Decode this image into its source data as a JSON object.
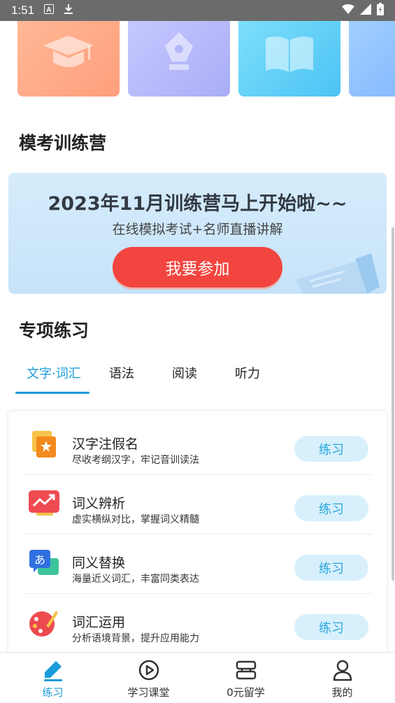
{
  "status_bar": {
    "time": "1:51",
    "icons": [
      "a-icon",
      "download-icon",
      "wifi-icon",
      "signal-icon",
      "battery-icon"
    ]
  },
  "top_cards": [
    {
      "name": "graduation-cap-icon",
      "color": "#ffa685"
    },
    {
      "name": "pen-nib-icon",
      "color": "#b4b7f9"
    },
    {
      "name": "open-book-icon",
      "color": "#5ecbf6"
    },
    {
      "name": "card-icon",
      "color": "#8dbcff"
    }
  ],
  "mock_exam": {
    "section_title": "模考训练营",
    "banner_title": "2023年11月训练营马上开始啦~~",
    "banner_subtitle": "在线模拟考试+名师直播讲解",
    "join_button": "我要参加"
  },
  "practice": {
    "section_title": "专项练习",
    "tabs": [
      "文字·词汇",
      "语法",
      "阅读",
      "听力"
    ],
    "active_tab": 0,
    "items": [
      {
        "title": "汉字注假名",
        "desc": "尽收考纲汉字，牢记音训读法",
        "button": "练习",
        "icon": "kanji-star-icon"
      },
      {
        "title": "词义辨析",
        "desc": "虚实横纵对比，掌握词义精髓",
        "button": "练习",
        "icon": "trend-chart-icon"
      },
      {
        "title": "同义替换",
        "desc": "海量近义词汇，丰富同类表达",
        "button": "练习",
        "icon": "translate-chat-icon"
      },
      {
        "title": "词汇运用",
        "desc": "分析语境背景，提升应用能力",
        "button": "练习",
        "icon": "palette-icon"
      }
    ]
  },
  "bottom_nav": [
    {
      "label": "练习",
      "icon": "pencil-icon",
      "active": true
    },
    {
      "label": "学习课堂",
      "icon": "play-circle-icon",
      "active": false
    },
    {
      "label": "0元留学",
      "icon": "layers-icon",
      "active": false
    },
    {
      "label": "我的",
      "icon": "person-icon",
      "active": false
    }
  ],
  "colors": {
    "accent": "#1a9bdb",
    "join_button": "#f2453f",
    "practice_button_bg": "#d7f0fc"
  }
}
